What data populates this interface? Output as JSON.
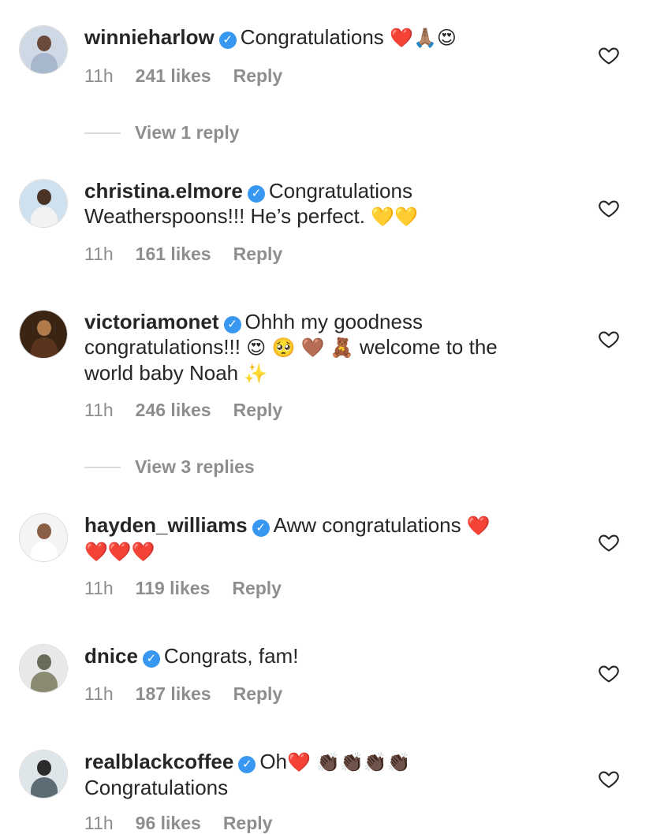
{
  "comments": [
    {
      "username": "winnieharlow",
      "text_lines": [
        "Congratulations",
        ""
      ],
      "emojis": [
        "❤️",
        "🙏🏽",
        "😍"
      ],
      "time": "11h",
      "likes": "241 likes",
      "reply": "Reply",
      "avatar_colors": [
        "#cfd9e6",
        "#6b4a3a",
        "#a7b8cc"
      ]
    },
    {
      "username": "christina.elmore",
      "text_lines": [
        "Congratulations",
        "Weatherspoons!!! He’s perfect."
      ],
      "emojis": [
        "💛",
        "💛"
      ],
      "time": "11h",
      "likes": "161 likes",
      "reply": "Reply",
      "avatar_colors": [
        "#cfe0ee",
        "#4a3226",
        "#f2f2f2"
      ]
    },
    {
      "username": "victoriamonet",
      "text_lines": [
        "Ohhh my goodness",
        "congratulations!!!",
        "welcome to the",
        "world baby Noah"
      ],
      "emojis": [
        "😍",
        "🥺",
        "🤎",
        "🧸",
        "✨"
      ],
      "time": "11h",
      "likes": "246 likes",
      "reply": "Reply",
      "avatar_colors": [
        "#3a2414",
        "#b07a4a",
        "#5a341c"
      ]
    },
    {
      "username": "hayden_williams",
      "text_lines": [
        "Aww congratulations",
        ""
      ],
      "emojis": [
        "❤️",
        "❤️",
        "❤️",
        "❤️"
      ],
      "time": "11h",
      "likes": "119 likes",
      "reply": "Reply",
      "avatar_colors": [
        "#f4f4f4",
        "#8a5e45",
        "#ffffff"
      ]
    },
    {
      "username": "dnice",
      "text_lines": [
        "Congrats, fam!"
      ],
      "emojis": [],
      "time": "11h",
      "likes": "187 likes",
      "reply": "Reply",
      "avatar_colors": [
        "#e8e8e8",
        "#6a6a5a",
        "#8a8a72"
      ]
    },
    {
      "username": "realblackcoffee",
      "text_lines": [
        "Oh",
        "Congratulations"
      ],
      "emojis": [
        "❤️",
        "👏🏿",
        "👏🏿",
        "👏🏿",
        "👏🏿"
      ],
      "time": "11h",
      "likes": "96 likes",
      "reply": "Reply",
      "avatar_colors": [
        "#dfe6ea",
        "#2b2b2b",
        "#5c6b74"
      ]
    }
  ],
  "view_replies": [
    "View 1 reply",
    "View 3 replies"
  ],
  "icons": {
    "verified": "verified-badge-icon",
    "like": "heart-outline-icon"
  },
  "colors": {
    "verified": "#3897f0",
    "muted": "#8e8e8e",
    "text": "#262626"
  }
}
